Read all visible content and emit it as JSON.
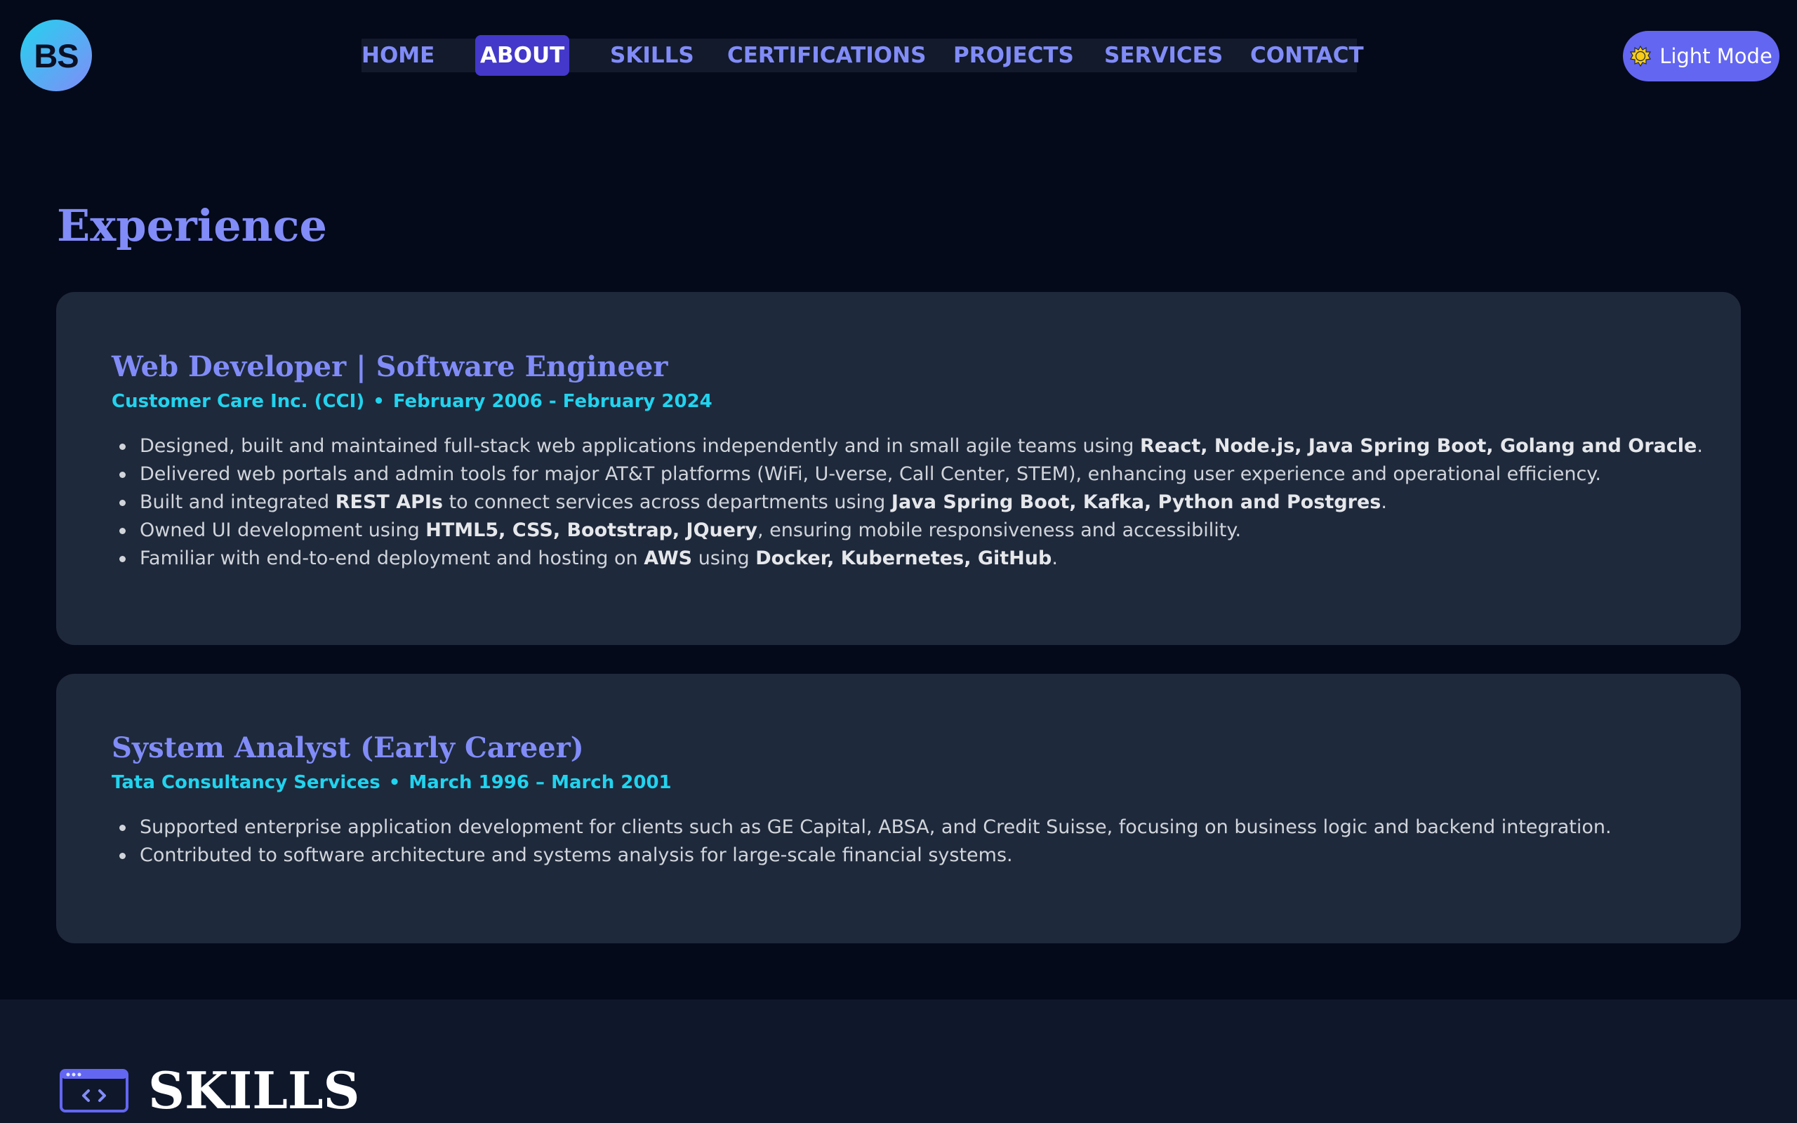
{
  "header": {
    "logo_text": "BS",
    "nav": [
      "HOME",
      "ABOUT",
      "SKILLS",
      "CERTIFICATIONS",
      "PROJECTS",
      "SERVICES",
      "CONTACT"
    ],
    "active_nav": "ABOUT",
    "theme_toggle": {
      "icon": "sun-icon",
      "label": "Light Mode"
    }
  },
  "experience": {
    "title": "Experience",
    "jobs": [
      {
        "title": "Web Developer | Software Engineer",
        "company": "Customer Care Inc. (CCI)",
        "separator": "•",
        "dates": "February 2006 - February 2024",
        "bullets": [
          [
            {
              "text": "Designed, built and maintained full-stack web applications independently and in small agile teams using "
            },
            {
              "text": "React, Node.js, Java Spring Boot, Golang and Oracle",
              "bold": true
            },
            {
              "text": "."
            }
          ],
          [
            {
              "text": "Delivered web portals and admin tools for major AT&T platforms (WiFi, U-verse, Call Center, STEM), enhancing user experience and operational efficiency."
            }
          ],
          [
            {
              "text": "Built and integrated "
            },
            {
              "text": "REST APIs",
              "bold": true
            },
            {
              "text": " to connect services across departments using "
            },
            {
              "text": "Java Spring Boot, Kafka, Python and Postgres",
              "bold": true
            },
            {
              "text": "."
            }
          ],
          [
            {
              "text": "Owned UI development using "
            },
            {
              "text": "HTML5, CSS, Bootstrap, JQuery",
              "bold": true
            },
            {
              "text": ", ensuring mobile responsiveness and accessibility."
            }
          ],
          [
            {
              "text": "Familiar with end-to-end deployment and hosting on "
            },
            {
              "text": "AWS",
              "bold": true
            },
            {
              "text": " using "
            },
            {
              "text": "Docker, Kubernetes, GitHub",
              "bold": true
            },
            {
              "text": "."
            }
          ]
        ]
      },
      {
        "title": "System Analyst (Early Career)",
        "company": "Tata Consultancy Services",
        "separator": "•",
        "dates": "March 1996 – March 2001",
        "bullets": [
          [
            {
              "text": "Supported enterprise application development for clients such as GE Capital, ABSA, and Credit Suisse, focusing on business logic and backend integration."
            }
          ],
          [
            {
              "text": "Contributed to software architecture and systems analysis for large-scale financial systems."
            }
          ]
        ]
      }
    ]
  },
  "skills": {
    "icon": "code-window-icon",
    "title": "SKILLS"
  },
  "colors": {
    "background": "#050a1a",
    "card": "#1e293b",
    "accent": "#818cf8",
    "meta": "#22d3ee",
    "active_nav": "#4338ca",
    "toggle": "#6366f1"
  }
}
